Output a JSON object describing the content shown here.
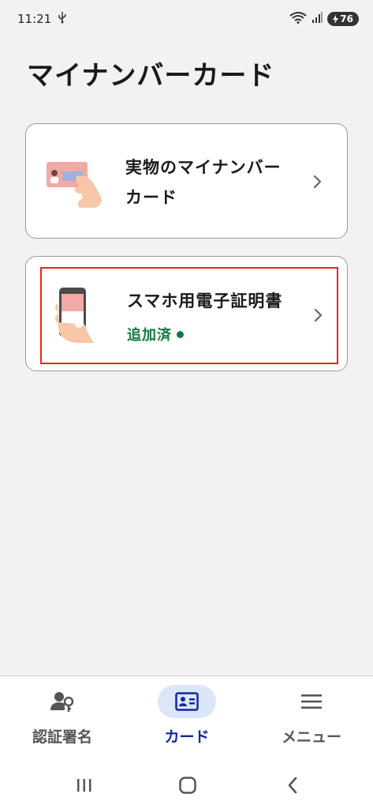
{
  "status_bar": {
    "time": "11:21",
    "usb_icon": "usb-icon",
    "wifi_icon": "wifi-6e-icon",
    "signal_icon": "signal-icon",
    "battery_level": "76"
  },
  "page": {
    "title": "マイナンバーカード"
  },
  "cards": {
    "physical": {
      "label_line1": "実物のマイナンバー",
      "label_line2": "カード",
      "icon": "id-card-in-hand-icon"
    },
    "phone": {
      "label": "スマホ用電子証明書",
      "status": "追加済",
      "icon": "smartphone-in-hand-icon",
      "status_color": "#137a41",
      "highlight_color": "#e3262a"
    }
  },
  "bottom_nav": {
    "items": [
      {
        "label": "認証署名",
        "icon": "user-key-icon",
        "active": false
      },
      {
        "label": "カード",
        "icon": "id-card-icon",
        "active": true
      },
      {
        "label": "メニュー",
        "icon": "hamburger-menu-icon",
        "active": false
      }
    ],
    "active_color": "#13279e",
    "active_bg": "#dbe6f9"
  },
  "system_nav": {
    "recents": "recents-icon",
    "home": "home-icon",
    "back": "back-icon"
  }
}
